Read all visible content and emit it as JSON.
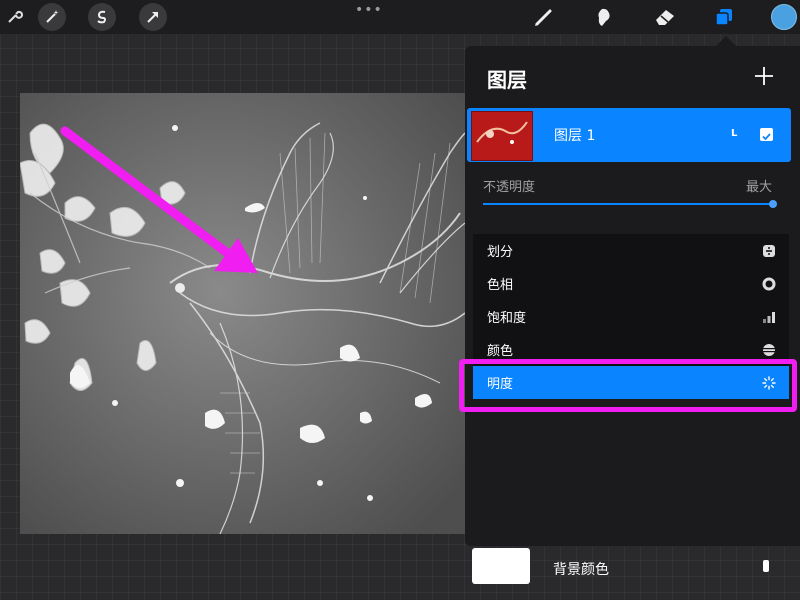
{
  "toolbar": {
    "left_tools": [
      "wrench-icon",
      "magic-wand-icon",
      "selection-s-icon",
      "transform-arrow-icon"
    ],
    "right_tools": [
      "brush-icon",
      "smudge-icon",
      "eraser-icon",
      "layers-icon",
      "color-swatch"
    ],
    "more": "•••",
    "active_color": "#4aa0e0"
  },
  "canvas": {
    "annotation_color": "#f01ef0",
    "theme": "phoenix-artwork"
  },
  "layers_panel": {
    "title": "图层",
    "add_icon": "+",
    "layer": {
      "name": "图层 1",
      "blend_mode": "L",
      "visible": true
    },
    "opacity_label": "不透明度",
    "opacity_value_label": "最大",
    "opacity_fraction": 1.0,
    "menu": [
      {
        "label": "划分",
        "icon": "divide-icon"
      },
      {
        "label": "色相",
        "icon": "hue-ring-icon"
      },
      {
        "label": "饱和度",
        "icon": "saturation-bars-icon"
      },
      {
        "label": "颜色",
        "icon": "color-stripes-icon"
      },
      {
        "label": "明度",
        "icon": "luminosity-sun-icon",
        "selected": true
      }
    ],
    "background": {
      "label": "背景颜色",
      "swatch_color": "#ffffff"
    }
  },
  "colors": {
    "accent": "#0a84ff",
    "highlight": "#f01ef0",
    "panel": "#1b1b1d"
  }
}
